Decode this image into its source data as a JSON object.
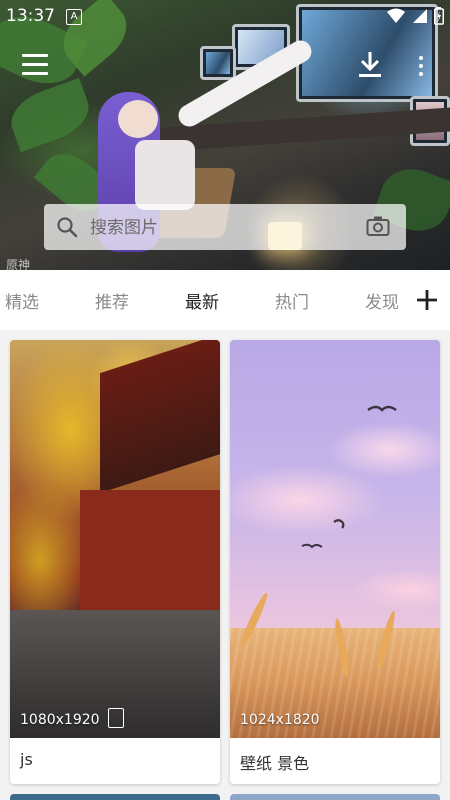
{
  "status_bar": {
    "time": "13:37",
    "notification_letter": "A"
  },
  "hero": {
    "watermark": "原神"
  },
  "search": {
    "placeholder": "搜索图片"
  },
  "tabs": [
    {
      "label": "精选",
      "active": false
    },
    {
      "label": "推荐",
      "active": false
    },
    {
      "label": "最新",
      "active": true
    },
    {
      "label": "热门",
      "active": false
    },
    {
      "label": "发现",
      "active": false
    }
  ],
  "cards": [
    {
      "resolution": "1080x1920",
      "title": "js"
    },
    {
      "resolution": "1024x1820",
      "title": "壁纸 景色"
    }
  ],
  "colors": {
    "active_tab": "#222222",
    "inactive_tab": "#8b8b8b",
    "page_background": "#f2f2f2"
  }
}
